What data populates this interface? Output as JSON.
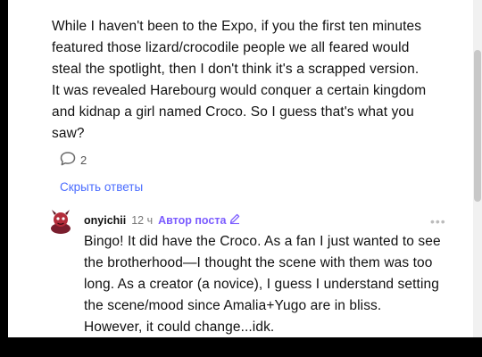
{
  "comment": {
    "lines": [
      "While I haven't been to the Expo, if you the first ten minutes",
      "featured those lizard/crocodile people we all feared would",
      "steal the spotlight, then I don't think it's a scrapped version.",
      "It was revealed Harebourg would conquer a certain kingdom",
      "and kidnap a girl named Croco. So I guess that's what you",
      "saw?"
    ],
    "reply_count": "2",
    "hide_replies_label": "Скрыть ответы"
  },
  "reply": {
    "username": "onyichii",
    "time": "12 ч",
    "author_badge": "Автор поста",
    "more_label": "•••",
    "lines": [
      "Bingo! It did have the Croco. As a fan I just wanted to see",
      "the brotherhood—I thought the scene with them was too",
      "long. As a creator (a novice), I guess I understand setting",
      "the scene/mood since Amalia+Yugo are in bliss.",
      "However, it could change...idk."
    ]
  },
  "colors": {
    "link": "#4a6cff",
    "badge": "#7b5cff"
  },
  "icons": {
    "reply": "speech-bubble-icon",
    "badge": "pencil-icon",
    "avatar": "avatar-character-icon"
  }
}
